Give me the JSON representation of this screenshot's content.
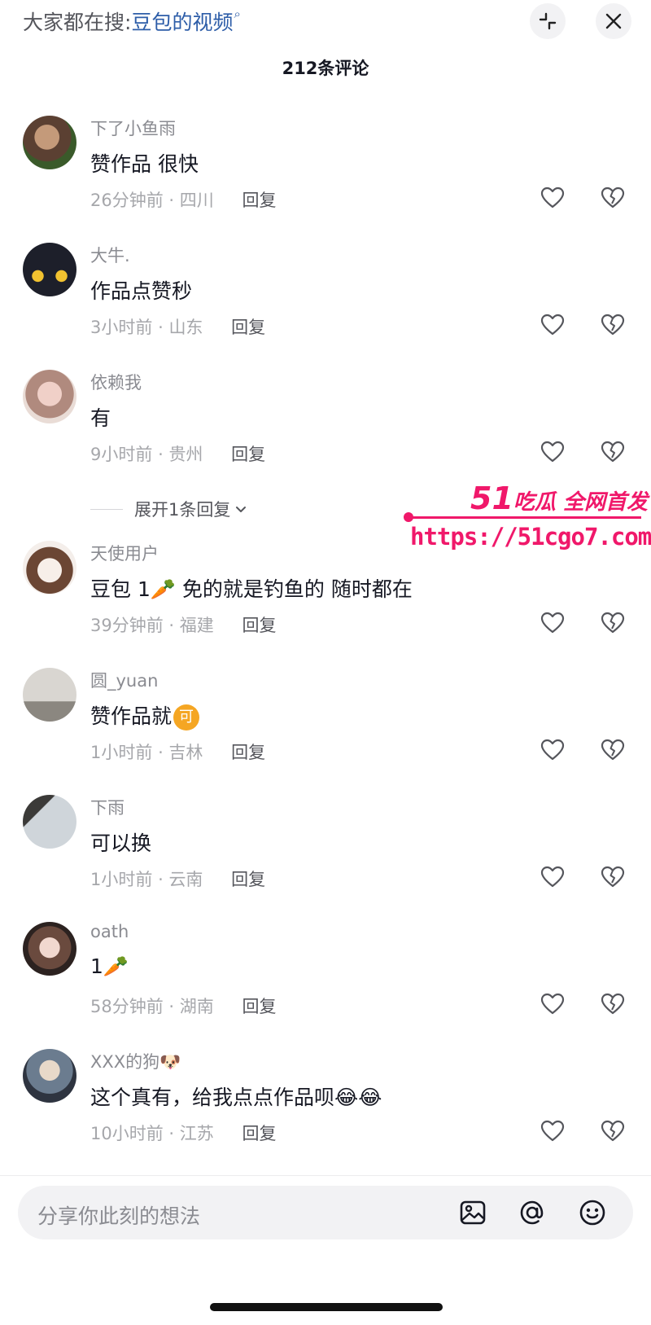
{
  "header": {
    "search_prefix": "大家都在搜:",
    "search_term": "豆包的视频",
    "search_icon": "search-icon",
    "collapse_icon": "collapse-icon",
    "close_icon": "close-icon"
  },
  "comment_count": "212条评论",
  "comments": [
    {
      "username": "下了小鱼雨",
      "text": "赞作品 很快",
      "time": "26分钟前",
      "location": "四川",
      "separator": "·",
      "reply": "回复"
    },
    {
      "username": "大牛.",
      "text": "作品点赞秒",
      "time": "3小时前",
      "location": "山东",
      "separator": "·",
      "reply": "回复"
    },
    {
      "username": "依赖我",
      "text": "有",
      "time": "9小时前",
      "location": "贵州",
      "separator": "·",
      "reply": "回复"
    },
    {
      "username": "天使用户",
      "text": "豆包 1🥕 免的就是钓鱼的 随时都在",
      "time": "39分钟前",
      "location": "福建",
      "separator": "·",
      "reply": "回复"
    },
    {
      "username": "圆_yuan",
      "text": "赞作品就",
      "badge": "可",
      "time": "1小时前",
      "location": "吉林",
      "separator": "·",
      "reply": "回复"
    },
    {
      "username": "下雨",
      "text": "可以换",
      "time": "1小时前",
      "location": "云南",
      "separator": "·",
      "reply": "回复"
    },
    {
      "username": "oath",
      "text": "1🥕",
      "time": "58分钟前",
      "location": "湖南",
      "separator": "·",
      "reply": "回复"
    },
    {
      "username": "XXX的狗🐶",
      "text": "这个真有，给我点点作品呗😂😂",
      "time": "10小时前",
      "location": "江苏",
      "separator": "·",
      "reply": "回复"
    }
  ],
  "expand_replies": "展开1条回复",
  "watermark": {
    "number": "51",
    "title": "吃瓜 全网首发",
    "url": "https://51cgo7.com"
  },
  "input": {
    "placeholder": "分享你此刻的想法",
    "image_icon": "image-icon",
    "mention_icon": "at-icon",
    "emoji_icon": "smiley-icon"
  },
  "colors": {
    "accent_link": "#2d5da8",
    "watermark": "#f0186a",
    "badge": "#f5a623"
  }
}
